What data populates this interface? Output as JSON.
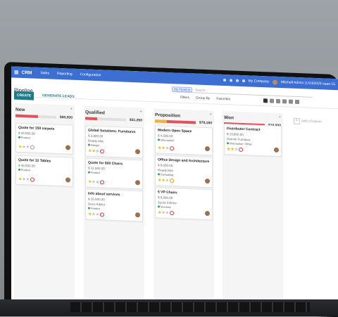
{
  "navbar": {
    "apps_icon": "grid-icon",
    "brand": "CRM",
    "menus": [
      "Sales",
      "Reporting",
      "Configuration"
    ],
    "company": "My Company",
    "user": "Mitchell Admin (14162025-saas-15"
  },
  "control_panel": {
    "title": "Pipeline",
    "search_facet": "My Pipeline",
    "search_placeholder": "Search...",
    "filters": "Filters",
    "group_by": "Group By",
    "favorites": "Favorites",
    "create": "CREATE",
    "generate_leads": "GENERATE LEADS"
  },
  "columns": [
    {
      "name": "New",
      "total": "$80,000",
      "progress": {
        "red": 0.55,
        "yellow": 0
      },
      "cards": [
        {
          "title": "Quote for 150 carpets",
          "amount": "$ 40,000.00",
          "sub": "",
          "tag": "Product",
          "stars": 1,
          "activity": "gray"
        },
        {
          "title": "Quote for 12 Tables",
          "amount": "$ 40,000.00",
          "sub": "",
          "tag": "Product",
          "stars": 1,
          "activity": "red"
        }
      ]
    },
    {
      "name": "Qualified",
      "total": "$51,350",
      "progress": {
        "red": 0.3,
        "yellow": 0
      },
      "cards": [
        {
          "title": "Global Solutions: Furnitures",
          "amount": "$ 3,800.00",
          "sub": "Ready Mat",
          "tag": "Design",
          "stars": 2,
          "activity": "red"
        },
        {
          "title": "Quote for 600 Chairs",
          "amount": "$ 22,500.00",
          "sub": "",
          "tag": "Product",
          "stars": 1,
          "activity": "red"
        },
        {
          "title": "Info about services",
          "amount": "$ 25,000.00",
          "sub": "Deco Addict",
          "tag": "Product",
          "stars": 1,
          "activity": "red"
        }
      ]
    },
    {
      "name": "Proposition",
      "total": "$79,180",
      "progress": {
        "red": 1.0,
        "yellow": 0.3
      },
      "cards": [
        {
          "title": "Modern Open Space",
          "amount": "$ 4,500.00",
          "sub": "",
          "tag": "Information",
          "stars": 2,
          "activity": "red"
        },
        {
          "title": "Office Design and Architecture",
          "amount": "$ 9,000.00",
          "sub": "Ready Mat",
          "tag": "Consulting",
          "stars": 2,
          "activity": "y"
        },
        {
          "title": "5 VP Chairs",
          "amount": "$ 5,600.00",
          "sub": "Azure Interior",
          "tag": "Services",
          "stars": 1,
          "activity": "red"
        }
      ]
    },
    {
      "name": "Won",
      "total": "$19,800",
      "progress": {
        "red": 1.0,
        "yellow": 0
      },
      "cards": [
        {
          "title": "Distributor Contract",
          "amount": "$ 19,800.00",
          "sub": "Gemini Furniture",
          "tag": "Information • Other",
          "stars": 2,
          "activity": "red"
        }
      ]
    }
  ],
  "add_column": "Add a Column",
  "colors": {
    "navbar": "#3c6fd1",
    "create": "#1f7a8c",
    "danger": "#e0535d",
    "warning": "#f0b23c"
  }
}
